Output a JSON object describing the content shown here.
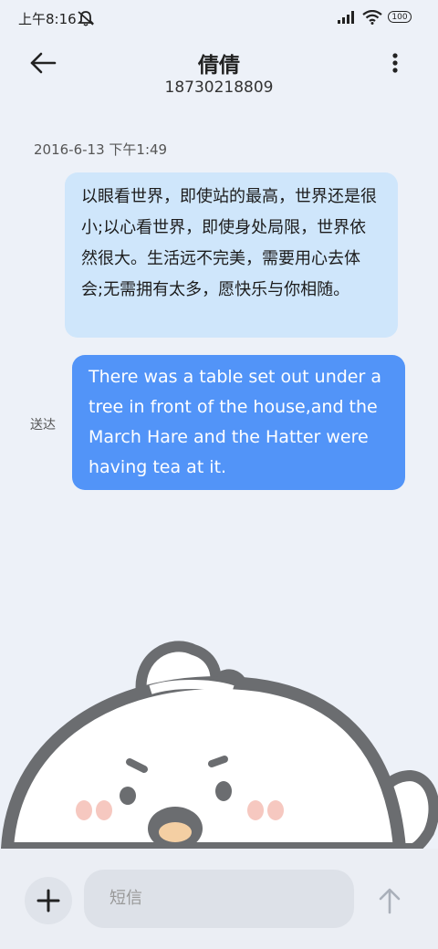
{
  "status": {
    "time": "上午8:16",
    "battery": "100"
  },
  "header": {
    "contact_name": "倩倩",
    "phone_number": "18730218809"
  },
  "conversation": {
    "timestamp": "2016-6-13 下午1:49",
    "received_message": "以眼看世界，即使站的最高，世界还是很小;以心看世界，即使身处局限，世界依然很大。生活远不完美，需要用心去体会;无需拥有太多，愿快乐与你相随。",
    "sent_status": "送达",
    "sent_message": "There was a table set out under a tree in front of the house,and the March Hare and the Hatter were having tea at it."
  },
  "composer": {
    "placeholder": "短信"
  },
  "colors": {
    "background": "#edf1f8",
    "received_bubble": "#cfe6fb",
    "sent_bubble": "#5294f8"
  },
  "icons": [
    "mute-icon",
    "signal-icon",
    "wifi-icon",
    "battery-icon",
    "back-arrow-icon",
    "more-vert-icon",
    "plus-icon",
    "send-arrow-icon"
  ]
}
